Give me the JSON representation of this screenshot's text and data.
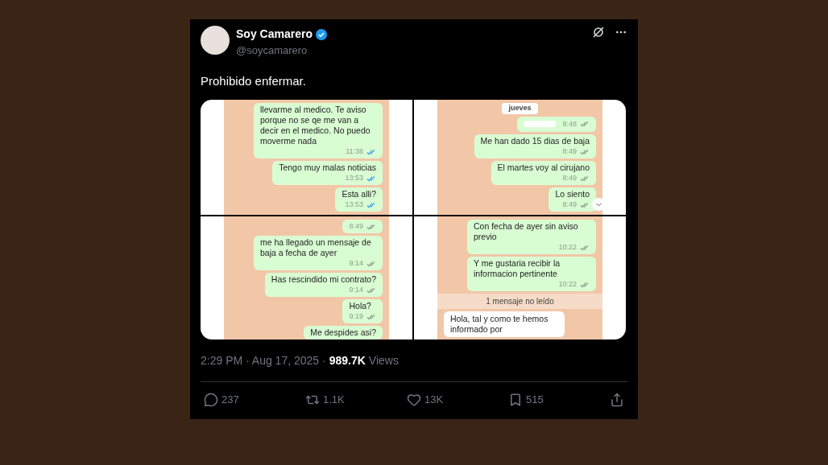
{
  "tweet": {
    "author": {
      "name": "Soy Camarero",
      "verified": true,
      "handle": "@soycamarero"
    },
    "text": "Prohibido enfermar.",
    "media": {
      "panels": [
        {
          "items": [
            {
              "kind": "out",
              "text": "llevarme al medico. Te aviso porque no se qe me van a decir en el medico. No puedo moverme nada",
              "time": "11:38",
              "read": true
            },
            {
              "kind": "out",
              "text": "Tengo muy malas noticias",
              "time": "13:53",
              "read": true
            },
            {
              "kind": "out",
              "text": "Esta alli?",
              "time": "13:53",
              "read": true
            }
          ]
        },
        {
          "scroll_down": true,
          "items": [
            {
              "kind": "date",
              "text": "jueves"
            },
            {
              "kind": "redacted",
              "time": "8:48",
              "read": false
            },
            {
              "kind": "out",
              "text": "Me han dado 15 dias de baja",
              "time": "8:49",
              "read": false
            },
            {
              "kind": "out",
              "text": "El martes voy al cirujano",
              "time": "8:49",
              "read": false
            },
            {
              "kind": "out",
              "text": "Lo siento",
              "time": "8:49",
              "read": false
            }
          ]
        },
        {
          "items": [
            {
              "kind": "out",
              "time": "8:49",
              "read": false
            },
            {
              "kind": "out",
              "text": "me ha llegado un mensaje de baja a fecha de ayer",
              "time": "9:14",
              "read": false
            },
            {
              "kind": "out",
              "text": "Has rescindido mi contrato?",
              "time": "9:14",
              "read": false
            },
            {
              "kind": "out",
              "text": "Hola?",
              "time": "9:19",
              "read": false
            },
            {
              "kind": "out",
              "text": "Me despides asi?"
            }
          ]
        },
        {
          "items": [
            {
              "kind": "out",
              "text": "Con fecha de ayer sin aviso previo",
              "time": "10:22",
              "read": false
            },
            {
              "kind": "out",
              "text": "Y me gustaria recibir la informacion pertinente",
              "time": "10:22",
              "read": false
            },
            {
              "kind": "unread",
              "text": "1 mensaje no leído"
            },
            {
              "kind": "in",
              "text": "Hola, tal y como te hemos informado por"
            }
          ]
        }
      ]
    },
    "timestamp": "2:29 PM · Aug 17, 2025 ·",
    "views": "989.7K",
    "views_label": "Views",
    "actions": [
      {
        "kind": "reply",
        "count": "237"
      },
      {
        "kind": "repost",
        "count": "1.1K"
      },
      {
        "kind": "like",
        "count": "13K"
      },
      {
        "kind": "bookmark",
        "count": "515"
      },
      {
        "kind": "share"
      }
    ]
  }
}
